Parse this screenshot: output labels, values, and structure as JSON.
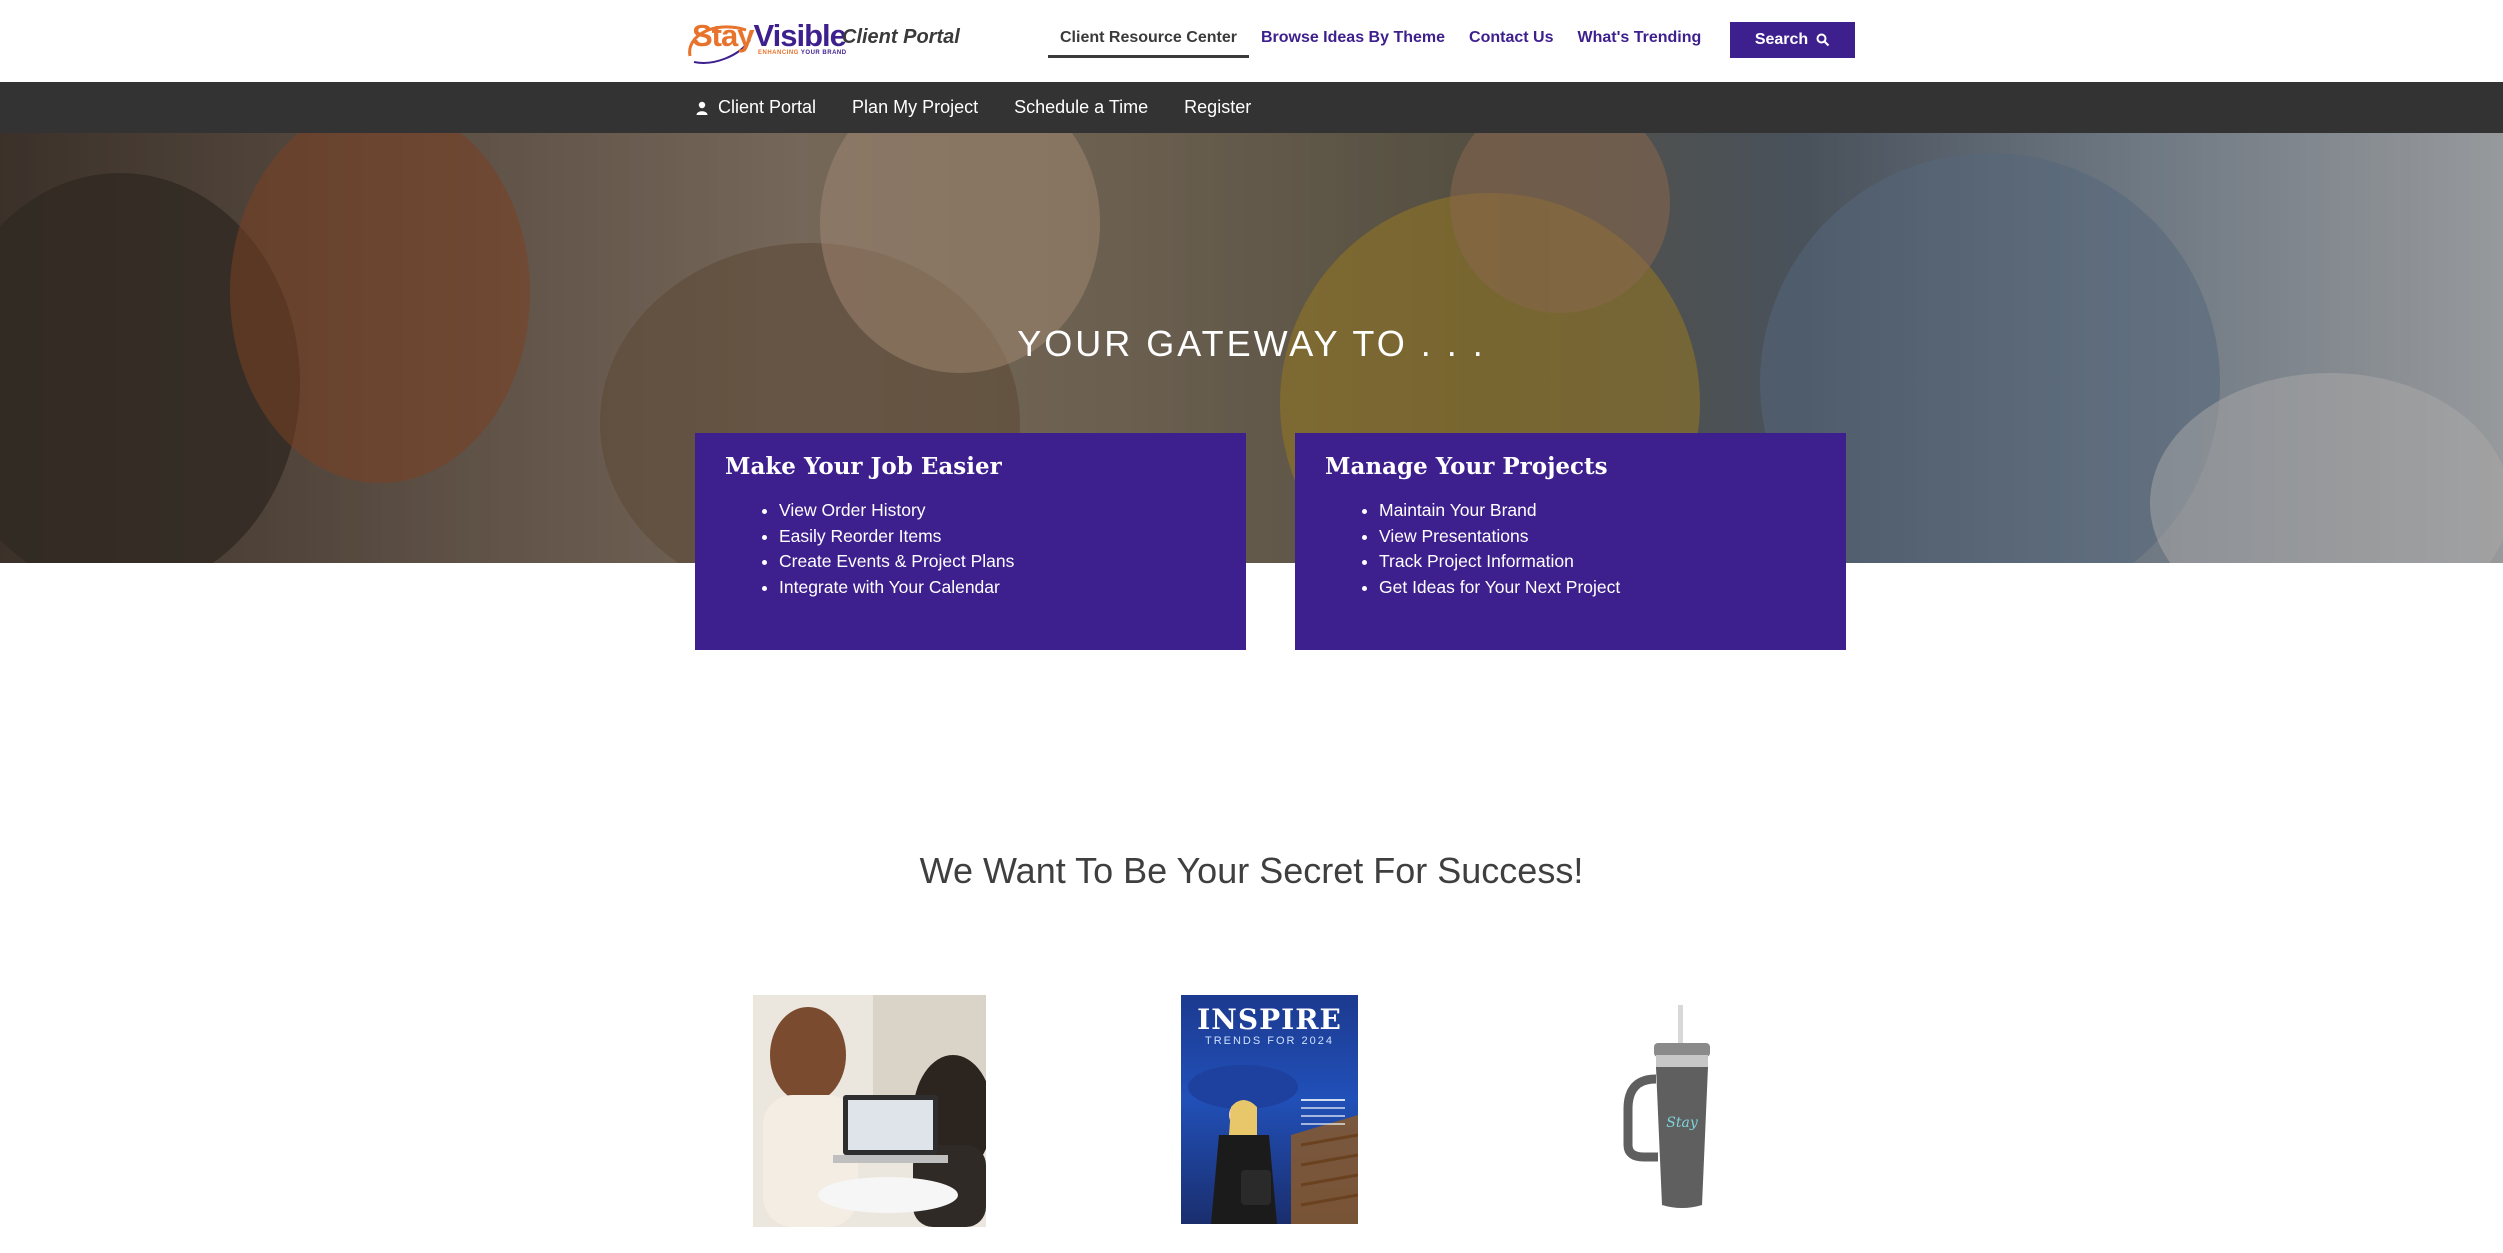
{
  "header": {
    "logo_stay": "Stay",
    "logo_visible": "Visible",
    "logo_tagline_highlight": "ENHANCING",
    "logo_tagline_rest": " YOUR BRAND",
    "portal_label": "Client Portal",
    "nav": [
      {
        "label": "Client Resource Center",
        "active": true
      },
      {
        "label": "Browse Ideas By Theme"
      },
      {
        "label": "Contact Us"
      },
      {
        "label": "What's Trending"
      }
    ],
    "search_label": "Search"
  },
  "subnav": {
    "items": [
      {
        "label": "Client Portal",
        "icon": "user-icon"
      },
      {
        "label": "Plan My Project"
      },
      {
        "label": "Schedule a Time"
      },
      {
        "label": "Register"
      }
    ]
  },
  "hero": {
    "title": "YOUR GATEWAY TO . . ."
  },
  "features": [
    {
      "title": "Make Your Job Easier",
      "items": [
        "View Order History",
        "Easily Reorder Items",
        "Create Events & Project Plans",
        "Integrate with Your Calendar"
      ]
    },
    {
      "title": "Manage Your Projects",
      "items": [
        "Maintain Your Brand",
        "View Presentations",
        "Track Project Information",
        "Get Ideas for Your Next Project"
      ]
    }
  ],
  "headline": "We Want To Be Your Secret For Success!",
  "products": {
    "magazine_title": "INSPIRE",
    "magazine_subtitle": "TRENDS FOR 2024"
  },
  "colors": {
    "brand_purple": "#3d1f8e",
    "brand_orange": "#e8732c",
    "subnav_bg": "#333333"
  }
}
